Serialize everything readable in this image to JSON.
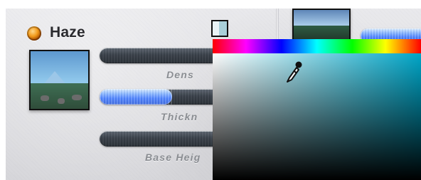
{
  "panel": {
    "title": "Haze",
    "led_color": "#f29a1b",
    "labels": {
      "density": "Dens",
      "thickness": "Thickn",
      "base_height": "Base Heig"
    },
    "sliders": {
      "density_fill_percent": 0,
      "thickness_fill_percent": 60,
      "base_height_fill_percent": 0
    }
  },
  "color_picker": {
    "swatch_color": "#a9d0da",
    "hue_bar": "hue-spectrum",
    "saturation_field": "sv-field",
    "icon": "eyedropper-icon"
  }
}
